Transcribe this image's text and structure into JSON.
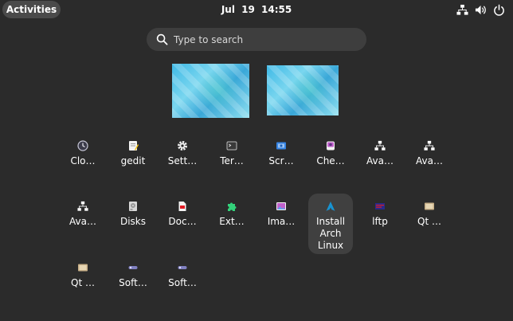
{
  "topbar": {
    "activities_label": "Activities",
    "clock": "Jul 19  14:55",
    "tray_icons": [
      "network-icon",
      "volume-icon",
      "power-icon"
    ]
  },
  "search": {
    "placeholder": "Type to search"
  },
  "apps": [
    {
      "label": "Clo…",
      "icon": "clock-icon"
    },
    {
      "label": "gedit",
      "icon": "gedit-icon"
    },
    {
      "label": "Sett…",
      "icon": "gear-icon"
    },
    {
      "label": "Ter…",
      "icon": "terminal-icon"
    },
    {
      "label": "Scr…",
      "icon": "screenshot-icon"
    },
    {
      "label": "Che…",
      "icon": "cheese-icon"
    },
    {
      "label": "Ava…",
      "icon": "network-icon"
    },
    {
      "label": "Ava…",
      "icon": "network-icon"
    },
    {
      "label": "Ava…",
      "icon": "network-icon"
    },
    {
      "label": "Disks",
      "icon": "disks-icon"
    },
    {
      "label": "Doc…",
      "icon": "document-icon"
    },
    {
      "label": "Ext…",
      "icon": "puzzle-icon"
    },
    {
      "label": "Ima…",
      "icon": "image-viewer-icon"
    },
    {
      "label": "Install Arch Linux",
      "icon": "arch-icon"
    },
    {
      "label": "lftp",
      "icon": "lftp-icon"
    },
    {
      "label": "Qt …",
      "icon": "qt-icon"
    },
    {
      "label": "Qt …",
      "icon": "qt-icon"
    },
    {
      "label": "Soft…",
      "icon": "software-icon"
    },
    {
      "label": "Soft…",
      "icon": "software-icon"
    }
  ]
}
